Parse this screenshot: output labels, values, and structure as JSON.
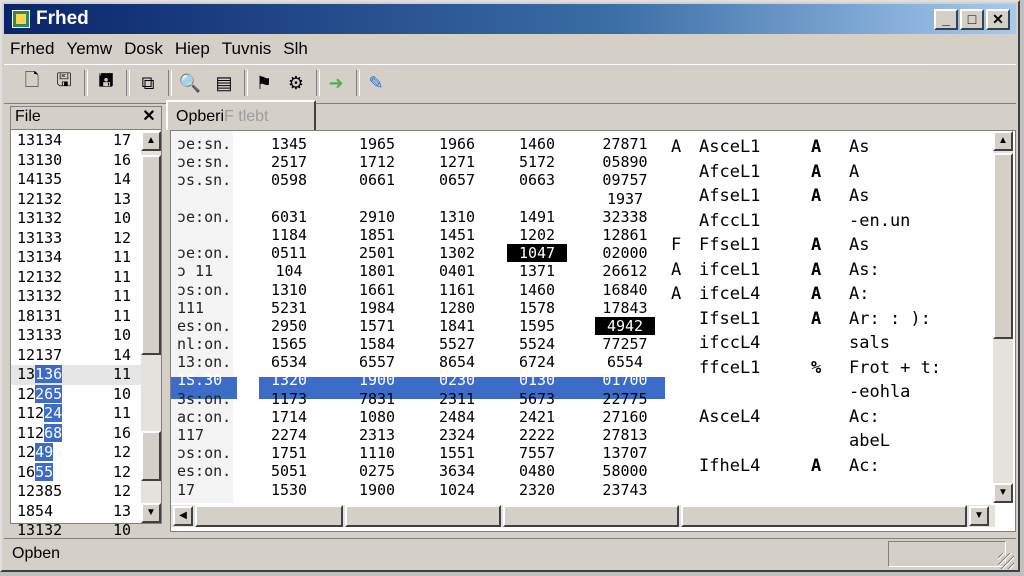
{
  "window": {
    "title": "Frhed",
    "minimize": "_",
    "maximize": "□",
    "close": "✕"
  },
  "menu": [
    "Frhed",
    "Yemw",
    "Dosk",
    "Hiep",
    "Tuvnis",
    "Slh"
  ],
  "toolbar": {
    "icons": [
      "new-file-icon",
      "open-file-icon",
      "save-icon",
      "copy-icon",
      "find-icon",
      "properties-icon",
      "bookmark-icon",
      "settings-icon",
      "navigate-icon",
      "tools-icon"
    ]
  },
  "left_panel": {
    "header": "File",
    "close": "✕",
    "rows": [
      {
        "n": "13134",
        "v": "17"
      },
      {
        "n": "13130",
        "v": "16"
      },
      {
        "n": "14135",
        "v": "14"
      },
      {
        "n": "12132",
        "v": "13"
      },
      {
        "n": "13132",
        "v": "10"
      },
      {
        "n": "13133",
        "v": "12"
      },
      {
        "n": "13134",
        "v": "11"
      },
      {
        "n": "12132",
        "v": "11"
      },
      {
        "n": "13132",
        "v": "11"
      },
      {
        "n": "18131",
        "v": "11"
      },
      {
        "n": "13133",
        "v": "10"
      },
      {
        "n": "12137",
        "v": "14"
      },
      {
        "n_a": "13",
        "n_b": "136",
        "v": "11"
      },
      {
        "n_a": "12",
        "n_b": "265",
        "v": "10"
      },
      {
        "n_a": "112",
        "n_b": "24",
        "v": "11"
      },
      {
        "n_a": "112",
        "n_b": "68",
        "v": "16"
      },
      {
        "n_a": "12",
        "n_b": "49",
        "v": "12"
      },
      {
        "n_a": "16",
        "n_b": "55",
        "v": "12"
      },
      {
        "n": "12385",
        "v": "12"
      },
      {
        "n": "1854",
        "v": "13"
      },
      {
        "n": "13132",
        "v": "10"
      }
    ]
  },
  "tab": {
    "label": "Opberi",
    "ghost": "F tlebt"
  },
  "hex_rows": [
    {
      "off": "ɔe:sn.",
      "c": [
        "1345",
        "1965",
        "1966",
        "1460",
        "27871"
      ]
    },
    {
      "off": "ɔe:sn.",
      "c": [
        "2517",
        "1712",
        "1271",
        "5172",
        "05890"
      ]
    },
    {
      "off": "ɔs.sn.",
      "c": [
        "0598",
        "0661",
        "0657",
        "0663",
        "09757"
      ]
    },
    {
      "off": "",
      "c": [
        "",
        "",
        "",
        "",
        "1937"
      ]
    },
    {
      "off": "ɔe:on.",
      "c": [
        "6031",
        "2910",
        "1310",
        "1491",
        "32338"
      ]
    },
    {
      "off": "",
      "c": [
        "1184",
        "1851",
        "1451",
        "1202",
        "12861"
      ]
    },
    {
      "off": "ɔe:on.",
      "c": [
        "0511",
        "2501",
        "1302",
        "1047",
        "02000"
      ]
    },
    {
      "off": "ɔ 11",
      "c": [
        "104",
        "1801",
        "0401",
        "1371",
        "26612"
      ]
    },
    {
      "off": "ɔs:on.",
      "c": [
        "1310",
        "1661",
        "1161",
        "1460",
        "16840"
      ]
    },
    {
      "off": "111",
      "c": [
        "5231",
        "1984",
        "1280",
        "1578",
        "17843"
      ]
    },
    {
      "off": "es:on.",
      "c": [
        "2950",
        "1571",
        "1841",
        "1595",
        "4942"
      ]
    },
    {
      "off": "nl:on.",
      "c": [
        "1565",
        "1584",
        "5527",
        "5524",
        "77257"
      ]
    },
    {
      "off": "13:on.",
      "c": [
        "6534",
        "6557",
        "8654",
        "6724",
        "6554"
      ]
    },
    {
      "off": "1S.30",
      "c": [
        "1320",
        "1900",
        "0230",
        "0130",
        "01700"
      ]
    },
    {
      "off": "3s:on.",
      "c": [
        "1173",
        "7831",
        "2311",
        "5673",
        "22775"
      ]
    },
    {
      "off": "ac:on.",
      "c": [
        "1714",
        "1080",
        "2484",
        "2421",
        "27160"
      ]
    },
    {
      "off": "117",
      "c": [
        "2274",
        "2313",
        "2324",
        "2222",
        "27813"
      ]
    },
    {
      "off": "ɔs:on.",
      "c": [
        "1751",
        "1110",
        "1551",
        "7557",
        "13707"
      ]
    },
    {
      "off": "es:on.",
      "c": [
        "5051",
        "0275",
        "3634",
        "0480",
        "58000"
      ]
    },
    {
      "off": "17",
      "c": [
        "1530",
        "1900",
        "1024",
        "2320",
        "23743"
      ]
    }
  ],
  "text_rows": [
    {
      "a": "A",
      "b": "AsceL1",
      "c": "A",
      "d": "As"
    },
    {
      "a": "",
      "b": "AfceL1",
      "c": "A",
      "d": "A"
    },
    {
      "a": "",
      "b": "AfseL1",
      "c": "A",
      "d": "As"
    },
    {
      "a": "",
      "b": "AfccL1",
      "c": "",
      "d": "-en.un"
    },
    {
      "a": "F",
      "b": "FfseL1",
      "c": "A",
      "d": "As"
    },
    {
      "a": "A",
      "b": "ifceL1",
      "c": "A",
      "d": "As:"
    },
    {
      "a": "A",
      "b": "ifceL4",
      "c": "A",
      "d": "A:"
    },
    {
      "a": "",
      "b": "IfseL1",
      "c": "A",
      "d": "Ar: : ):"
    },
    {
      "a": "",
      "b": "ifccL4",
      "c": "",
      "d": "sals"
    },
    {
      "a": "",
      "b": "ffceL1",
      "c": "%",
      "d": "Frot + t:"
    },
    {
      "a": "",
      "b": "",
      "c": "",
      "d": "-eohla"
    },
    {
      "a": "",
      "b": "AsceL4",
      "c": "",
      "d": "Ac:"
    },
    {
      "a": "",
      "b": "",
      "c": "",
      "d": "abeL"
    },
    {
      "a": "",
      "b": "IfheL4",
      "c": "A",
      "d": "Ac:"
    }
  ],
  "status": {
    "text": "Opben",
    "panel": ""
  }
}
